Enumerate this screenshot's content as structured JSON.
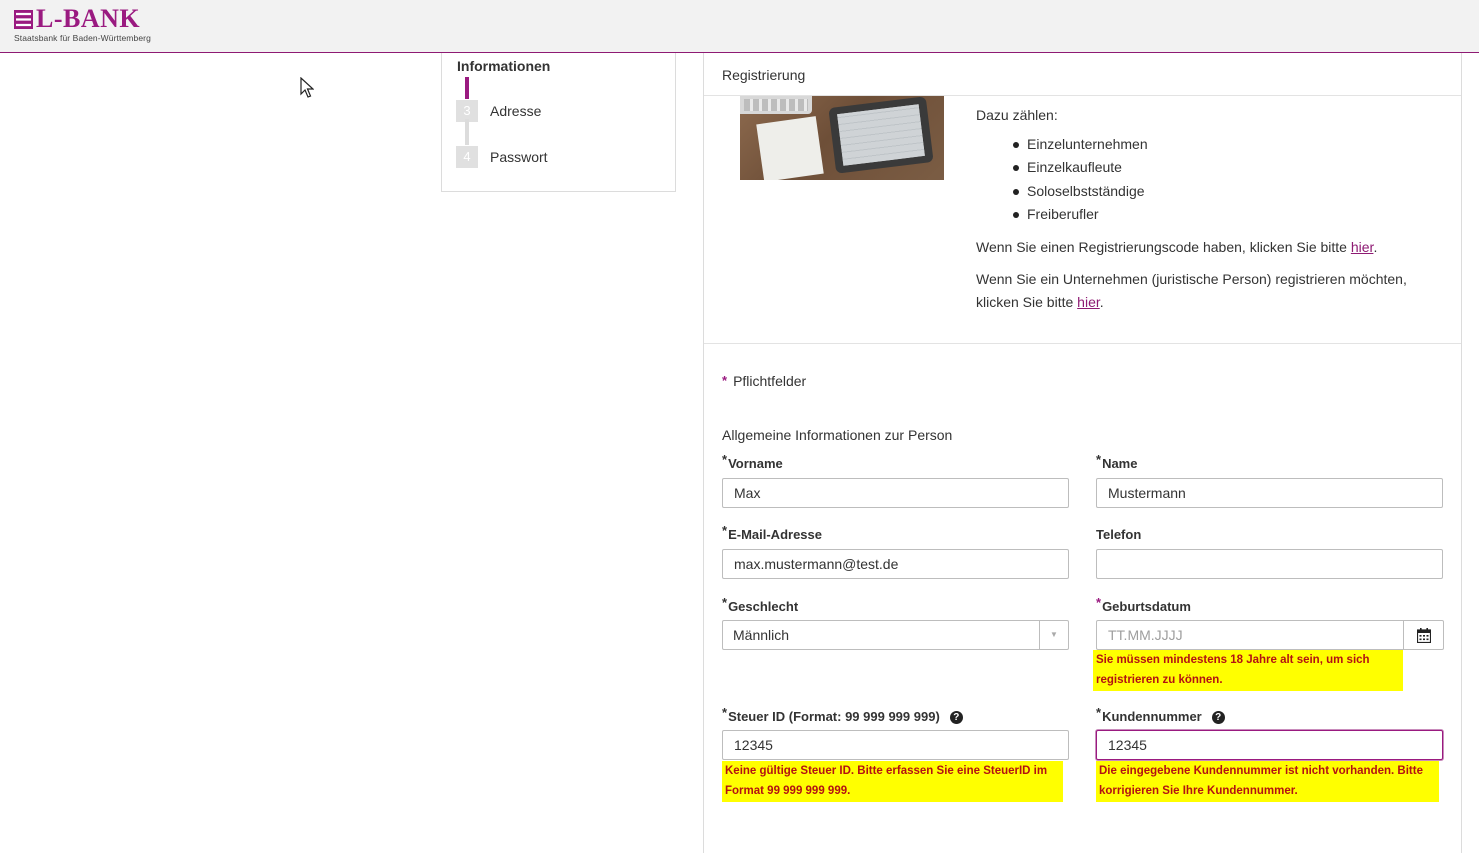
{
  "brand": {
    "name": "L-BANK",
    "tagline": "Staatsbank für Baden-Württemberg",
    "accent": "#9a1a80"
  },
  "steps": {
    "current_title": "Informationen",
    "items": [
      {
        "number": "3",
        "label": "Adresse"
      },
      {
        "number": "4",
        "label": "Passwort"
      }
    ]
  },
  "panel": {
    "title": "Registrierung",
    "intro": "Dazu zählen:",
    "types": [
      "Einzelunternehmen",
      "Einzelkaufleute",
      "Soloselbstständige",
      "Freiberufler"
    ],
    "code_text": "Wenn Sie einen Registrierungscode haben, klicken Sie bitte ",
    "code_link": "hier",
    "company_text": "Wenn Sie ein Unternehmen (juristische Person) registrieren möchten, klicken Sie bitte ",
    "company_link": "hier",
    "period": "."
  },
  "form": {
    "required_star": "*",
    "required_note": "Pflichtfelder",
    "section_title": "Allgemeine Informationen zur Person",
    "vorname": {
      "label": "Vorname",
      "value": "Max"
    },
    "name": {
      "label": "Name",
      "value": "Mustermann"
    },
    "email": {
      "label": "E-Mail-Adresse",
      "value": "max.mustermann@test.de"
    },
    "telefon": {
      "label": "Telefon",
      "value": ""
    },
    "geschlecht": {
      "label": "Geschlecht",
      "value": "Männlich",
      "arrow": "▼"
    },
    "geburtsdatum": {
      "label": "Geburtsdatum",
      "placeholder": "TT.MM.JJJJ",
      "error": "Sie müssen mindestens 18 Jahre alt sein, um sich registrieren zu können."
    },
    "steuer_id": {
      "label": "Steuer ID (Format: 99 999 999 999)",
      "value": "12345",
      "help": "?",
      "error": "Keine gültige Steuer ID. Bitte erfassen Sie eine SteuerID im Format 99 999 999 999."
    },
    "kundennummer": {
      "label": "Kundennummer",
      "value": "12345",
      "help": "?",
      "error": "Die eingegebene Kundennummer ist nicht vorhanden. Bitte korrigieren Sie Ihre Kundennummer."
    }
  }
}
